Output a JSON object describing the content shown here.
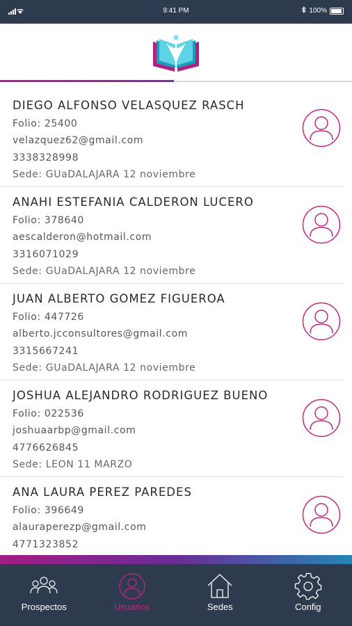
{
  "status_bar": {
    "time": "9:41 PM",
    "battery": "100%"
  },
  "colors": {
    "accent": "#c0277e",
    "navbar": "#2e3b4e",
    "teal": "#1aa9c4"
  },
  "users": [
    {
      "name": "DIEGO ALFONSO VELASQUEZ RASCH",
      "folio": "Folio: 25400",
      "email": "velazquez62@gmail.com",
      "phone": "3338328998",
      "sede": "Sede: GUaDALAJARA 12 noviembre"
    },
    {
      "name": "ANAHI ESTEFANIA CALDERON LUCERO",
      "folio": "Folio: 378640",
      "email": "aescalderon@hotmail.com",
      "phone": "3316071029",
      "sede": "Sede: GUaDALAJARA 12 noviembre"
    },
    {
      "name": "JUAN ALBERTO GOMEZ FIGUEROA",
      "folio": "Folio: 447726",
      "email": "alberto.jcconsultores@gmail.com",
      "phone": "3315667241",
      "sede": "Sede: GUaDALAJARA 12 noviembre"
    },
    {
      "name": "JOSHUA ALEJANDRO RODRIGUEZ BUENO",
      "folio": "Folio: 022536",
      "email": "joshuaarbp@gmail.com",
      "phone": "4776626845",
      "sede": "Sede: LEON 11 MARZO"
    },
    {
      "name": "ANA LAURA PEREZ PAREDES",
      "folio": "Folio: 396649",
      "email": "alauraperezp@gmail.com",
      "phone": "4771323852",
      "sede": ""
    }
  ],
  "tabs": {
    "prospectos": "Prospectos",
    "usuarios": "Usuarios",
    "sedes": "Sedes",
    "config": "Config"
  }
}
